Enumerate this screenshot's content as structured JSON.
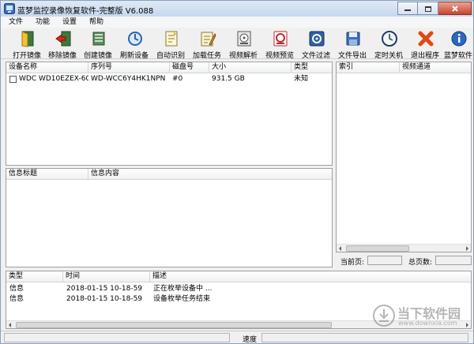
{
  "window": {
    "title": "蓝梦监控录像恢复软件-完整版 V6.088"
  },
  "menu": [
    "文件",
    "功能",
    "设置",
    "帮助"
  ],
  "toolbar": [
    {
      "label": "打开镜像",
      "icon": "open-image-icon"
    },
    {
      "label": "移除镜像",
      "icon": "remove-image-icon"
    },
    {
      "label": "创建镜像",
      "icon": "create-image-icon"
    },
    {
      "label": "刷新设备",
      "icon": "refresh-device-icon"
    },
    {
      "label": "自动识别",
      "icon": "auto-detect-icon"
    },
    {
      "label": "加载任务",
      "icon": "load-task-icon"
    },
    {
      "label": "视频解析",
      "icon": "video-parse-icon"
    },
    {
      "label": "视频预览",
      "icon": "video-preview-icon"
    },
    {
      "label": "文件过滤",
      "icon": "file-filter-icon"
    },
    {
      "label": "文件导出",
      "icon": "file-export-icon"
    },
    {
      "label": "定时关机",
      "icon": "timer-shutdown-icon"
    },
    {
      "label": "退出程序",
      "icon": "exit-icon"
    },
    {
      "label": "蓝梦软件",
      "icon": "info-icon"
    }
  ],
  "devices": {
    "columns": [
      "设备名称",
      "序列号",
      "磁盘号",
      "大小",
      "类型"
    ],
    "rows": [
      {
        "name": "WDC WD10EZEX-60...",
        "serial": "WD-WCC6Y4HK1NPN",
        "disk": "#0",
        "size": "931.5 GB",
        "type": "未知"
      }
    ]
  },
  "info": {
    "columns": [
      "信息标题",
      "信息内容"
    ]
  },
  "videos": {
    "columns": [
      "索引",
      "视频通道"
    ]
  },
  "pager": {
    "current_label": "当前页:",
    "total_label": "总页数:"
  },
  "log": {
    "columns": [
      "类型",
      "时间",
      "描述"
    ],
    "rows": [
      {
        "type": "信息",
        "time": "2018-01-15 10-18-59",
        "desc": "正在枚举设备中 ..."
      },
      {
        "type": "信息",
        "time": "2018-01-15 10-18-59",
        "desc": "设备枚举任务结束"
      }
    ]
  },
  "status": {
    "speed_label": "速度"
  },
  "watermark": {
    "brand": "当下软件园",
    "url": "www.downxia.com"
  }
}
